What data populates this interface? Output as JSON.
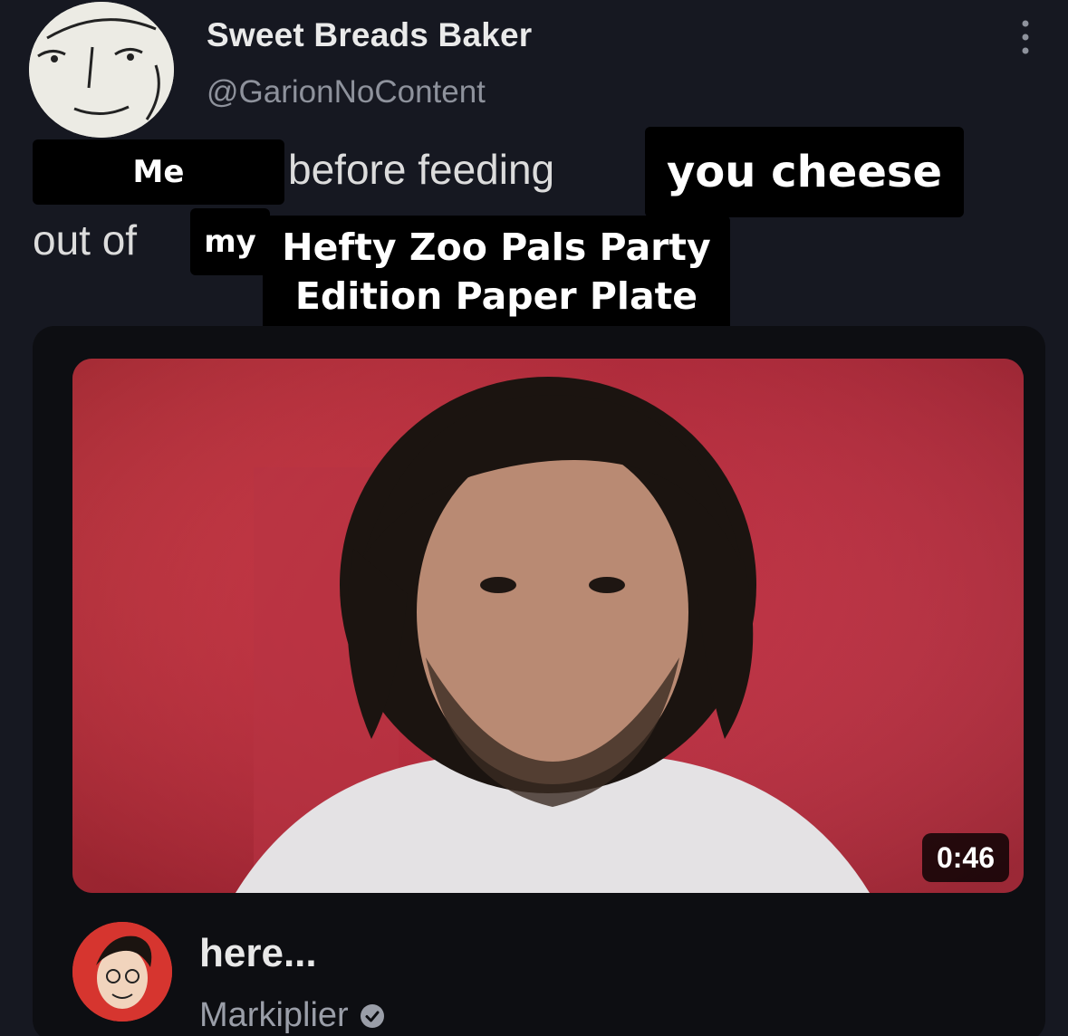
{
  "tweet": {
    "display_name": "Sweet Breads Baker",
    "handle": "@GarionNoContent",
    "text_line1": "before feeding",
    "text_line2": "out of",
    "more_icon": "more-vertical-icon"
  },
  "overlays": {
    "me": "Me",
    "you_cheese": "you cheese",
    "my": "my",
    "hefty_line1": "Hefty Zoo Pals Party",
    "hefty_line2": "Edition Paper Plate"
  },
  "video": {
    "duration": "0:46",
    "title": "here...",
    "channel": "Markiplier",
    "verified_icon": "verified-check-icon",
    "thumbnail_bg": "#c83a45"
  },
  "colors": {
    "background": "#161821",
    "card": "#0d0e12",
    "overlay": "#000000",
    "handle": "#8e929c"
  }
}
